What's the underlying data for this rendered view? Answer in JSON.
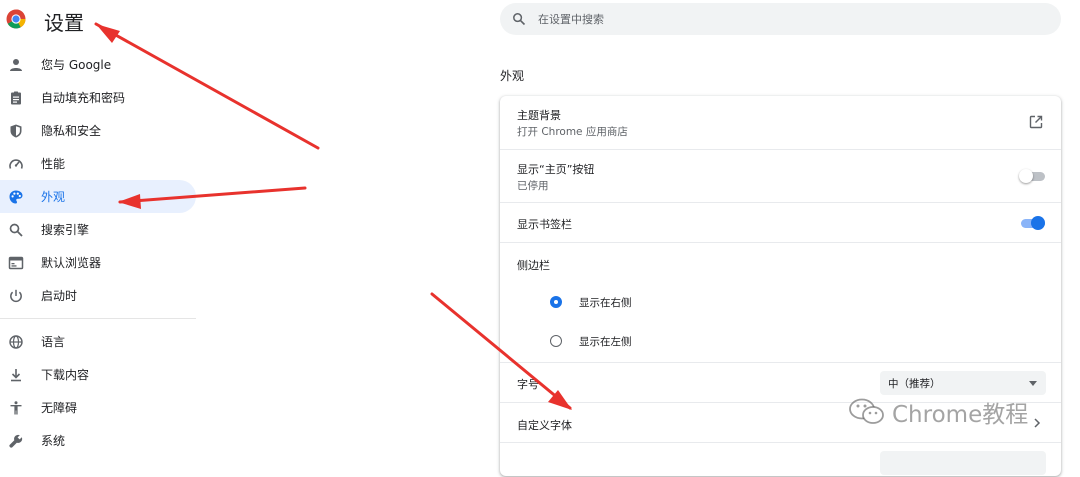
{
  "header": {
    "title": "设置"
  },
  "search": {
    "placeholder": "在设置中搜索"
  },
  "sidebar": {
    "items": [
      {
        "label": "您与 Google",
        "icon": "person-icon"
      },
      {
        "label": "自动填充和密码",
        "icon": "clipboard-icon"
      },
      {
        "label": "隐私和安全",
        "icon": "shield-icon"
      },
      {
        "label": "性能",
        "icon": "speedometer-icon"
      },
      {
        "label": "外观",
        "icon": "palette-icon",
        "active": true
      },
      {
        "label": "搜索引擎",
        "icon": "search-icon"
      },
      {
        "label": "默认浏览器",
        "icon": "browser-window-icon"
      },
      {
        "label": "启动时",
        "icon": "power-icon"
      },
      {
        "label": "语言",
        "icon": "globe-icon"
      },
      {
        "label": "下载内容",
        "icon": "download-icon"
      },
      {
        "label": "无障碍",
        "icon": "accessibility-icon"
      },
      {
        "label": "系统",
        "icon": "wrench-icon"
      }
    ]
  },
  "main": {
    "section_title": "外观",
    "theme": {
      "title": "主题背景",
      "subtitle": "打开 Chrome 应用商店"
    },
    "home_button": {
      "title": "显示“主页”按钮",
      "subtitle": "已停用",
      "enabled": false
    },
    "bookmarks_bar": {
      "title": "显示书签栏",
      "enabled": true
    },
    "side_panel": {
      "title": "侧边栏",
      "options": [
        {
          "label": "显示在右侧",
          "selected": true
        },
        {
          "label": "显示在左侧",
          "selected": false
        }
      ]
    },
    "font_size": {
      "title": "字号",
      "value": "中（推荐）"
    },
    "custom_fonts": {
      "title": "自定义字体"
    }
  },
  "watermark": {
    "text": "Chrome教程"
  },
  "colors": {
    "accent": "#1a73e8",
    "active_bg": "#e8f0fe",
    "arrow": "#e8322d"
  }
}
